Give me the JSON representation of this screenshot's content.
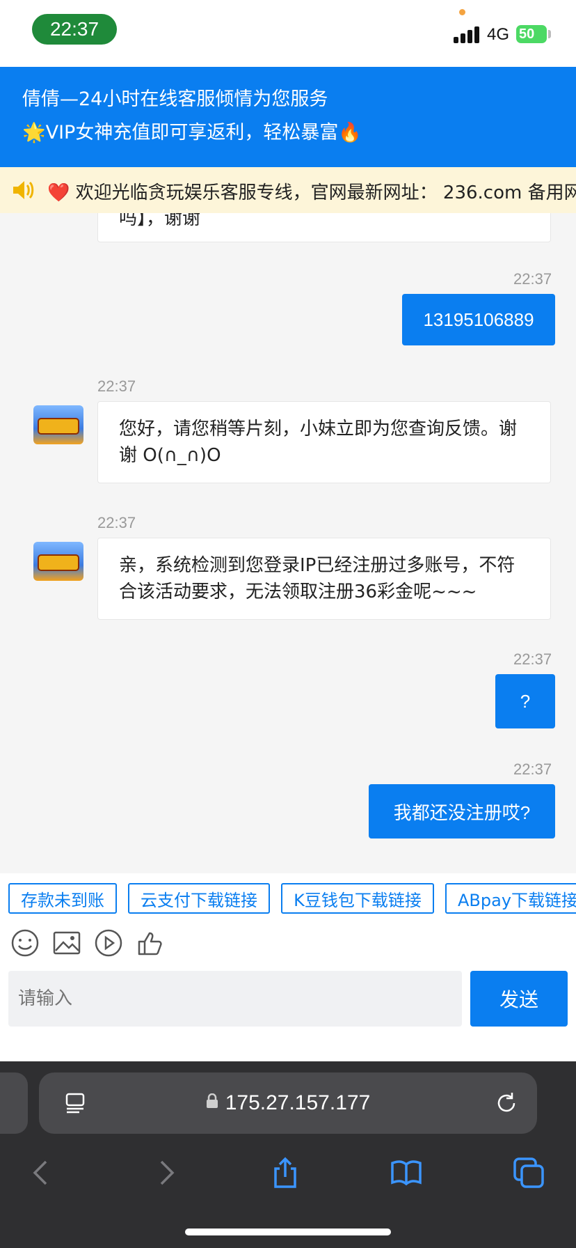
{
  "status_bar": {
    "time": "22:37",
    "network": "4G",
    "battery": "50"
  },
  "header": {
    "line1": "倩倩—24小时在线客服倾情为您服务",
    "line2": "🌟VIP女神充值即可享返利，轻松暴富🔥"
  },
  "notice": {
    "text": "❤️ 欢迎光临贪玩娱乐客服专线，官网最新网址： 236.com 备用网"
  },
  "messages": [
    {
      "side": "left",
      "text": "吗】，谢谢"
    },
    {
      "side": "right",
      "time": "22:37",
      "text": "13195106889"
    },
    {
      "side": "left",
      "time": "22:37",
      "text": "您好，请您稍等片刻，小妹立即为您查询反馈。谢谢 O(∩_∩)O"
    },
    {
      "side": "left",
      "time": "22:37",
      "text": "亲，系统检测到您登录IP已经注册过多账号，不符合该活动要求，无法领取注册36彩金呢~~~"
    },
    {
      "side": "right",
      "time": "22:37",
      "text": "?"
    },
    {
      "side": "right",
      "time": "22:37",
      "text": "我都还没注册哎?"
    }
  ],
  "quick_replies": [
    "存款未到账",
    "云支付下载链接",
    "K豆钱包下载链接",
    "ABpay下载链接"
  ],
  "input": {
    "placeholder": "请输入",
    "send_label": "发送"
  },
  "browser": {
    "url": "175.27.157.177"
  },
  "colors": {
    "primary": "#0a7ef0",
    "notice_bg": "#fdf5d9"
  }
}
